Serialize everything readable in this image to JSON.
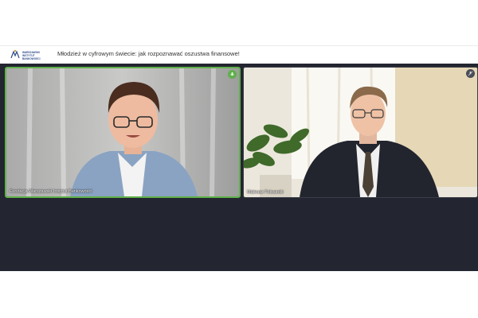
{
  "header": {
    "logo_text": "WARSZAWSKI\nINSTYTUT\nBANKOWOŚCI",
    "title": "Młodzież w cyfrowym świecie: jak rozpoznawać oszustwa finansowe!"
  },
  "participants": [
    {
      "name": "Fundacja Warszawski Instytut Bankowości",
      "speaking": true
    },
    {
      "name": "Mateusz Folwarski",
      "speaking": false
    }
  ],
  "colors": {
    "stage": "#232530",
    "active_border": "#5fb04a",
    "brand": "#2d4a8a"
  },
  "icons": [
    "wib-logo",
    "mic-icon",
    "muted-mic-icon"
  ]
}
